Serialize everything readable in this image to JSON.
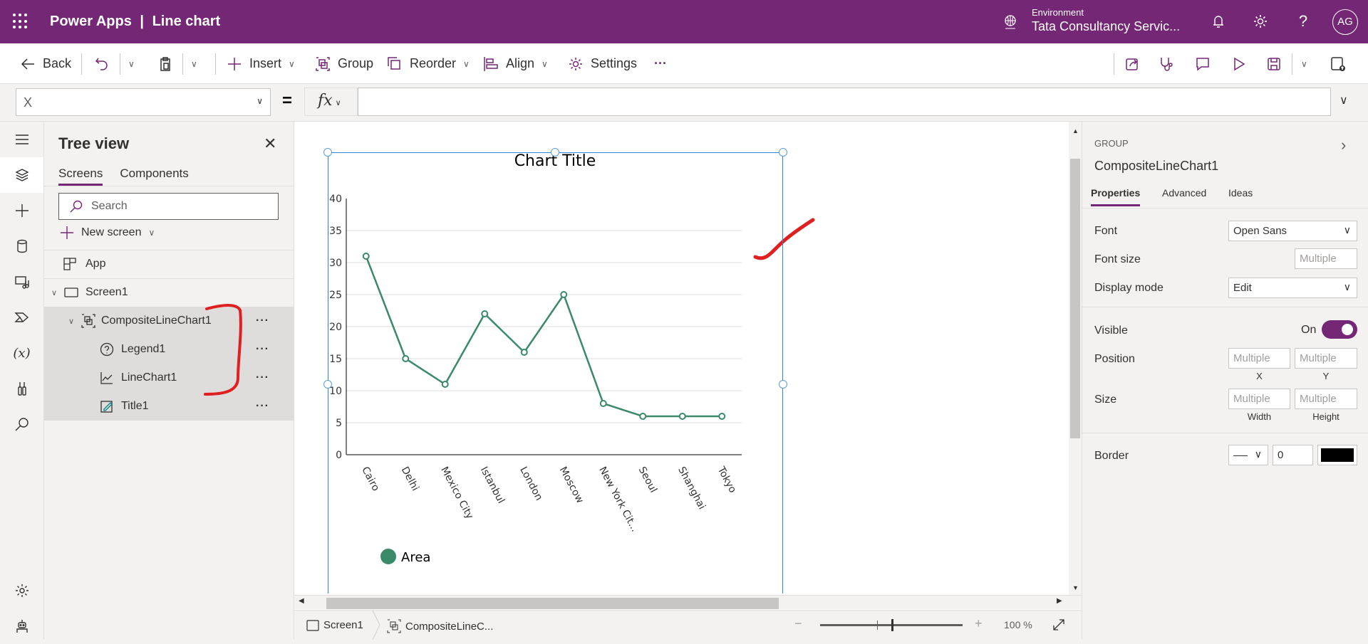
{
  "header": {
    "app_name": "Power Apps",
    "separator": "|",
    "doc_name": "Line chart",
    "environment_label": "Environment",
    "environment_name": "Tata Consultancy Servic...",
    "avatar_initials": "AG",
    "brand_color": "#742774"
  },
  "toolbar": {
    "back": "Back",
    "insert": "Insert",
    "group": "Group",
    "reorder": "Reorder",
    "align": "Align",
    "settings": "Settings",
    "more": "···"
  },
  "formula_bar": {
    "property": "X",
    "equals": "=",
    "fx": "fx",
    "formula": ""
  },
  "tree_view": {
    "title": "Tree view",
    "tabs": [
      {
        "label": "Screens",
        "active": true
      },
      {
        "label": "Components",
        "active": false
      }
    ],
    "search_placeholder": "Search",
    "new_screen": "New screen",
    "items": [
      {
        "label": "App",
        "icon": "app-icon",
        "level": 0
      },
      {
        "label": "Screen1",
        "icon": "screen-icon",
        "level": 0
      },
      {
        "label": "CompositeLineChart1",
        "icon": "group-icon",
        "level": 1,
        "selected": true
      },
      {
        "label": "Legend1",
        "icon": "legend-icon",
        "level": 2,
        "selected": true
      },
      {
        "label": "LineChart1",
        "icon": "line-chart-icon",
        "level": 2,
        "selected": true
      },
      {
        "label": "Title1",
        "icon": "label-icon",
        "level": 2,
        "selected": true
      }
    ],
    "more": "···"
  },
  "chart_data": {
    "type": "line",
    "title": "Chart Title",
    "categories": [
      "Cairo",
      "Delhi",
      "Mexico City",
      "Istanbul",
      "London",
      "Moscow",
      "New York Cit...",
      "Seoul",
      "Shanghai",
      "Tokyo"
    ],
    "series": [
      {
        "name": "Area",
        "values": [
          31,
          15,
          11,
          22,
          16,
          25,
          8,
          6,
          6,
          6
        ],
        "color": "#3a8a6a"
      }
    ],
    "yticks": [
      0,
      5,
      10,
      15,
      20,
      25,
      30,
      35,
      40
    ],
    "ylim": [
      0,
      40
    ],
    "xlabel": "",
    "ylabel": "",
    "grid": true,
    "legend": "bottom-left"
  },
  "status_bar": {
    "screen": "Screen1",
    "control": "CompositeLineC...",
    "zoom_minus": "−",
    "zoom_plus": "+",
    "zoom_percent": "100 %"
  },
  "properties_panel": {
    "type_label": "GROUP",
    "control_name": "CompositeLineChart1",
    "tabs": [
      {
        "label": "Properties",
        "active": true
      },
      {
        "label": "Advanced",
        "active": false
      },
      {
        "label": "Ideas",
        "active": false
      }
    ],
    "font_label": "Font",
    "font_value": "Open Sans",
    "font_size_label": "Font size",
    "font_size_placeholder": "Multiple",
    "display_mode_label": "Display mode",
    "display_mode_value": "Edit",
    "visible_label": "Visible",
    "visible_state": "On",
    "position_label": "Position",
    "position_x_placeholder": "Multiple",
    "position_y_placeholder": "Multiple",
    "x_label": "X",
    "y_label": "Y",
    "size_label": "Size",
    "width_placeholder": "Multiple",
    "height_placeholder": "Multiple",
    "width_label": "Width",
    "height_label": "Height",
    "border_label": "Border",
    "border_width": "0",
    "border_color": "#000000"
  }
}
